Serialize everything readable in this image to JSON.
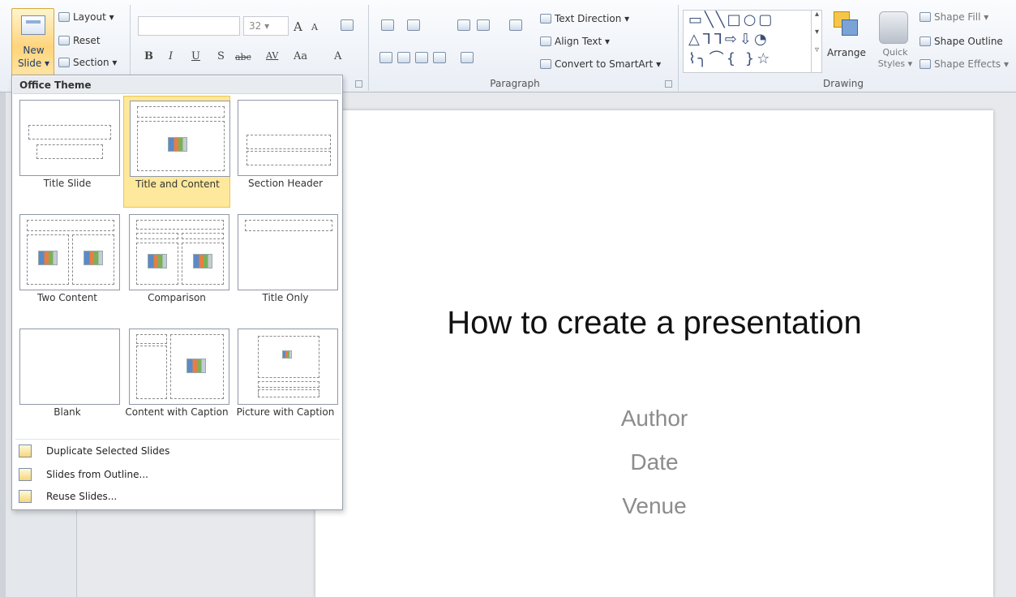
{
  "ribbon": {
    "slides_group": {
      "new_slide_line1": "New",
      "new_slide_line2": "Slide ▾",
      "layout": "Layout ▾",
      "reset": "Reset",
      "section": "Section ▾"
    },
    "font_group": {
      "font_name": "",
      "font_size": "32",
      "bold": "B",
      "italic": "I",
      "underline": "U",
      "shadow": "S",
      "strikethrough": "abc",
      "spacing": "AV",
      "change_case": "Aa",
      "font_color": "A",
      "grow": "A",
      "shrink": "A"
    },
    "paragraph_group": {
      "label": "Paragraph",
      "text_direction": "Text Direction ▾",
      "align_text": "Align Text ▾",
      "convert_smartart": "Convert to SmartArt ▾"
    },
    "drawing_group": {
      "label": "Drawing",
      "arrange": "Arrange",
      "quick_styles": "Quick Styles ▾",
      "shape_fill": "Shape Fill ▾",
      "shape_outline": "Shape Outline",
      "shape_effects": "Shape Effects ▾"
    }
  },
  "layout_menu": {
    "header": "Office Theme",
    "layouts": [
      {
        "label": "Title Slide"
      },
      {
        "label": "Title and Content"
      },
      {
        "label": "Section Header"
      },
      {
        "label": "Two Content"
      },
      {
        "label": "Comparison"
      },
      {
        "label": "Title Only"
      },
      {
        "label": "Blank"
      },
      {
        "label": "Content with Caption"
      },
      {
        "label": "Picture with Caption"
      }
    ],
    "selected": "Title and Content",
    "actions": [
      {
        "label": "Duplicate Selected Slides"
      },
      {
        "label": "Slides from Outline..."
      },
      {
        "label": "Reuse Slides..."
      }
    ]
  },
  "slide": {
    "title": "How to create a presentation",
    "author": "Author",
    "date": "Date",
    "venue": "Venue"
  },
  "colors": {
    "selection_highlight": "#fde89b",
    "new_slide_button": "#ffd47c"
  }
}
